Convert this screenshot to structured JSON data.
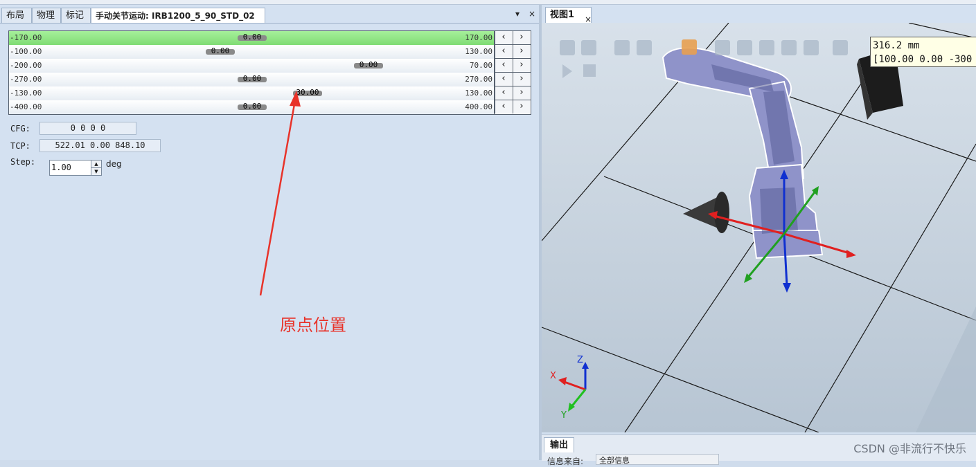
{
  "left_panel": {
    "tabs": [
      "布局",
      "物理",
      "标记",
      "手动关节运动: IRB1200_5_90_STD_02"
    ],
    "pin_icon": "▾",
    "close_icon": "×"
  },
  "joints": [
    {
      "min": "-170.00",
      "max": "170.00",
      "value": "0.00",
      "position": 0.5,
      "highlighted": true
    },
    {
      "min": "-100.00",
      "max": "130.00",
      "value": "0.00",
      "position": 0.435
    },
    {
      "min": "-200.00",
      "max": "70.00",
      "value": "0.00",
      "position": 0.741
    },
    {
      "min": "-270.00",
      "max": "270.00",
      "value": "0.00",
      "position": 0.5
    },
    {
      "min": "-130.00",
      "max": "130.00",
      "value": "30.00",
      "position": 0.615
    },
    {
      "min": "-400.00",
      "max": "400.00",
      "value": "0.00",
      "position": 0.5
    }
  ],
  "jog_buttons": {
    "left": "‹",
    "right": "›"
  },
  "fields": {
    "cfg_label": "CFG:",
    "cfg_value": "0 0 0 0",
    "tcp_label": "TCP:",
    "tcp_value": "522.01 0.00 848.10",
    "step_label": "Step:",
    "step_value": "1.00",
    "step_unit": "deg"
  },
  "annotation": {
    "text": "原点位置",
    "color": "#e8332a"
  },
  "viewport": {
    "tab_title": "视图1",
    "close_icon": "×",
    "tooltip_line1": "316.2 mm",
    "tooltip_line2": "[100.00 0.00 -300",
    "axis_x": "X",
    "axis_y": "Y",
    "axis_z": "Z",
    "robot_color": "#8f93c9",
    "floor_color": "#c6d3e0"
  },
  "output_panel": {
    "tab_title": "输出",
    "filter_label": "信息来自:",
    "filter_value": "全部信息"
  },
  "watermark": "CSDN @非流行不快乐"
}
